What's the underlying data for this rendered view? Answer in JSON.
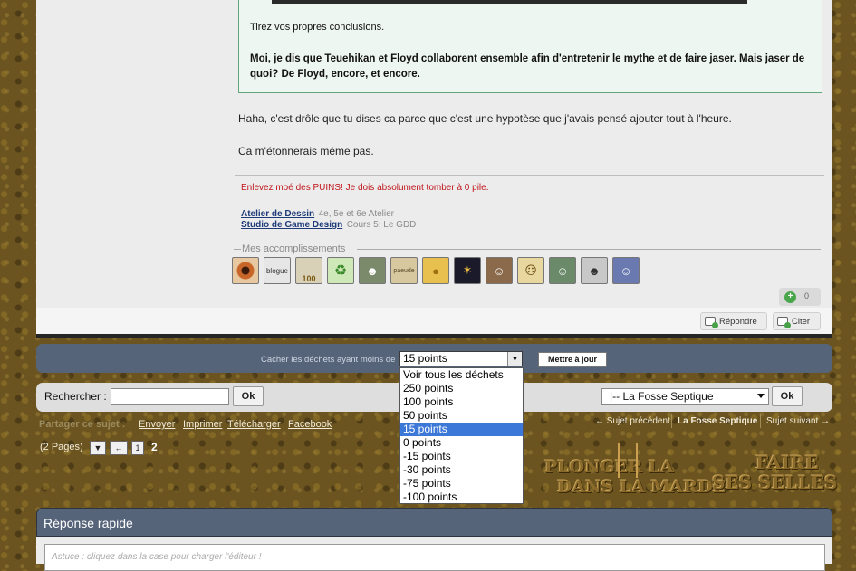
{
  "quote": {
    "line1": "Tirez vos propres conclusions.",
    "bold_text": "Moi, je dis que Teuehikan et Floyd collaborent ensemble afin d'entretenir le mythe et de faire jaser. Mais jaser de quoi? De Floyd, encore, et encore."
  },
  "post": {
    "line1": "Haha, c'est drôle que tu dises ca parce que c'est une hypotèse que j'avais pensé ajouter tout à l'heure.",
    "line2": "Ca m'étonnerais même pas."
  },
  "signature": {
    "red_text": "Enlevez moé des PUINS! Je dois absolument tomber à 0 pile.",
    "links": [
      {
        "label": "Atelier de Dessin",
        "sub": "4e, 5e et 6e Atelier"
      },
      {
        "label": "Studio de Game Design",
        "sub": "Cours 5: Le GDD"
      }
    ]
  },
  "achievements": {
    "title": "Mes accomplissements",
    "badges": [
      "eye",
      "blogue",
      "100",
      "recycle",
      "zombie",
      "parchment",
      "coins",
      "fireworks",
      "chief",
      "skull-face",
      "santa",
      "joker",
      "man"
    ],
    "badge_labels": {
      "blogue": "blogue",
      "100": "100",
      "parchment": "paeude"
    }
  },
  "vote": {
    "count": "0"
  },
  "actions": {
    "reply": "Répondre",
    "quote": "Citer"
  },
  "filter": {
    "label": "Cacher les déchets ayant moins de",
    "selected": "15 points",
    "options": [
      "Voir tous les déchets",
      "250 points",
      "100 points",
      "50 points",
      "15 points",
      "0 points",
      "-15 points",
      "-30 points",
      "-75 points",
      "-100 points"
    ],
    "update_label": "Mettre à jour"
  },
  "search": {
    "label": "Rechercher :",
    "ok": "Ok"
  },
  "forum_jump": {
    "selected": "|-- La Fosse Septique",
    "ok": "Ok"
  },
  "share": {
    "label": "Partager ce sujet :",
    "links": [
      "Envoyer",
      "Imprimer",
      "Télécharger",
      "Facebook"
    ]
  },
  "topic_nav": {
    "prev": "← Sujet précédent",
    "current": "La Fosse Septique",
    "next": "Sujet suivant →"
  },
  "pagination": {
    "pages_label": "(2 Pages)",
    "prev": "←",
    "page1": "1",
    "current": "2"
  },
  "logos": {
    "plunger": [
      "PLONGER LA",
      "DANS LA MARDE"
    ],
    "faire": [
      "FAIRE",
      "SES SELLES"
    ]
  },
  "quick_reply": {
    "title": "Réponse rapide",
    "tip": "Astuce : cliquez dans la case pour charger l'éditeur !"
  },
  "colors": {
    "bar": "#56647a",
    "panel": "#ececec",
    "selected": "#3b78d8",
    "sig_red": "#c0141a"
  }
}
